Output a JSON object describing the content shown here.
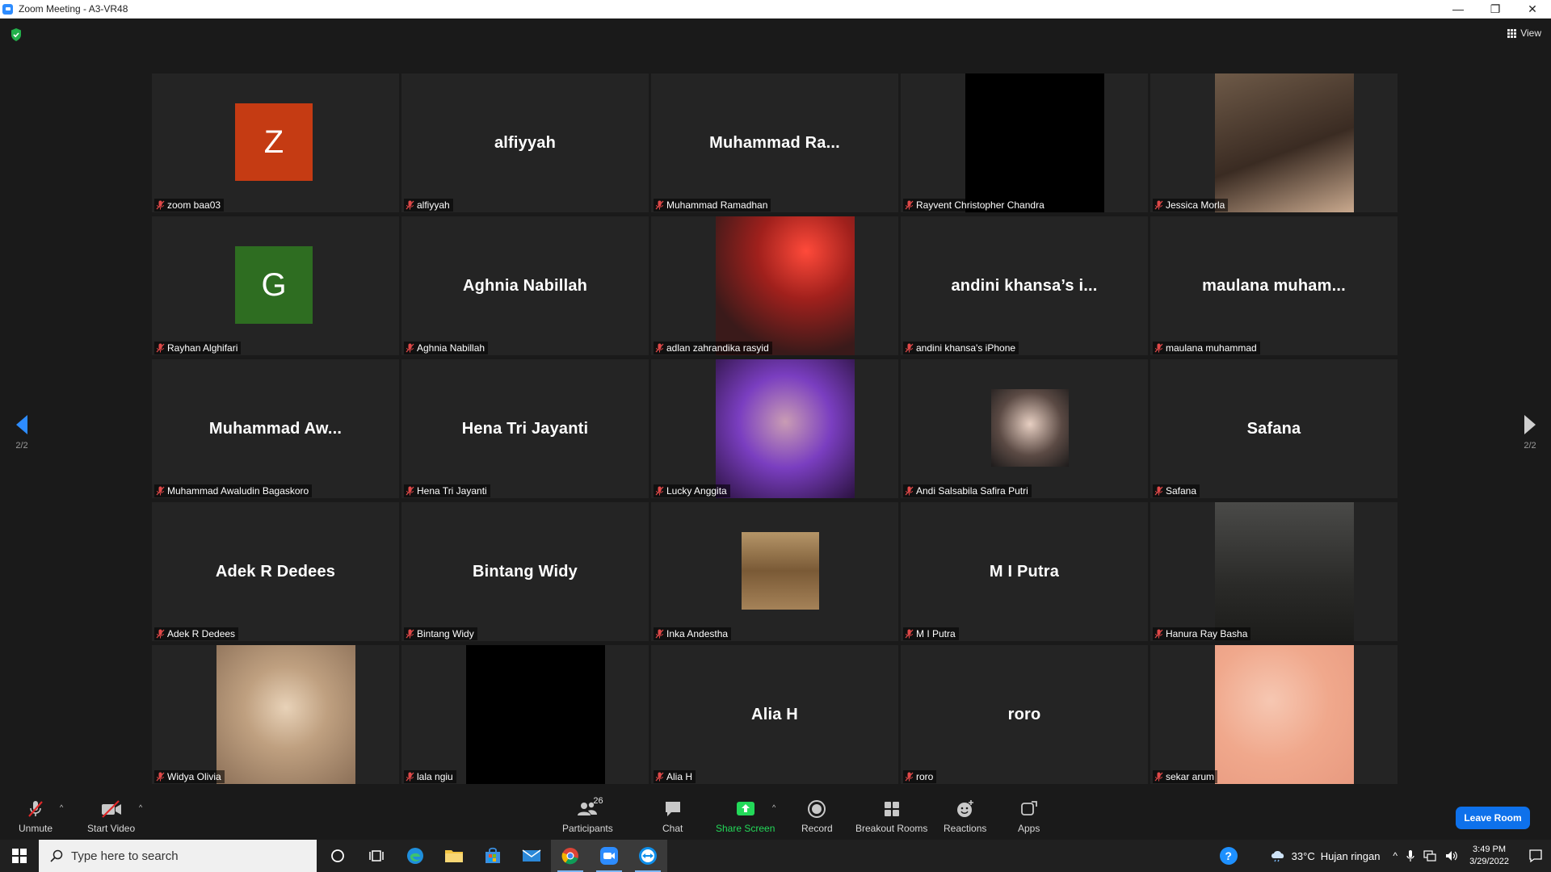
{
  "window": {
    "title": "Zoom Meeting - A3-VR48",
    "minimize": "—",
    "restore": "❐",
    "close": "✕"
  },
  "header": {
    "view_label": "View"
  },
  "pagination": {
    "left_page": "2/2",
    "right_page": "2/2"
  },
  "participants": [
    {
      "display": "Z",
      "kind": "avatar",
      "color": "#c53b13",
      "name": "zoom baa03"
    },
    {
      "display": "alfiyyah",
      "kind": "text",
      "name": "alfiyyah"
    },
    {
      "display": "Muhammad  Ra...",
      "kind": "text",
      "name": "Muhammad Ramadhan"
    },
    {
      "display": "",
      "kind": "video-black",
      "name": "Rayvent Christopher Chandra"
    },
    {
      "display": "",
      "kind": "video",
      "name": "Jessica Morla"
    },
    {
      "display": "G",
      "kind": "avatar",
      "color": "#2e6d21",
      "name": "Rayhan Alghifari"
    },
    {
      "display": "Aghnia Nabillah",
      "kind": "text",
      "name": "Aghnia Nabillah"
    },
    {
      "display": "",
      "kind": "video",
      "name": "adlan zahrandika rasyid"
    },
    {
      "display": "andini  khansa’s  i...",
      "kind": "text",
      "name": "andini khansa's iPhone"
    },
    {
      "display": "maulana  muham...",
      "kind": "text",
      "name": "maulana muhammad"
    },
    {
      "display": "Muhammad  Aw...",
      "kind": "text",
      "name": "Muhammad Awaludin Bagaskoro"
    },
    {
      "display": "Hena Tri Jayanti",
      "kind": "text",
      "name": "Hena Tri Jayanti"
    },
    {
      "display": "",
      "kind": "video",
      "name": "Lucky Anggita"
    },
    {
      "display": "",
      "kind": "photo-small",
      "name": "Andi Salsabila Safira Putri"
    },
    {
      "display": "Safana",
      "kind": "text",
      "name": "Safana"
    },
    {
      "display": "Adek R Dedees",
      "kind": "text",
      "name": "Adek R Dedees"
    },
    {
      "display": "Bintang Widy",
      "kind": "text",
      "name": "Bintang Widy"
    },
    {
      "display": "",
      "kind": "photo-small",
      "name": "Inka Andestha"
    },
    {
      "display": "M I Putra",
      "kind": "text",
      "name": "M I Putra"
    },
    {
      "display": "",
      "kind": "video",
      "name": "Hanura Ray Basha"
    },
    {
      "display": "",
      "kind": "video",
      "name": "Widya Olivia"
    },
    {
      "display": "",
      "kind": "video-black",
      "name": "lala ngiu"
    },
    {
      "display": "Alia H",
      "kind": "text",
      "name": "Alia H"
    },
    {
      "display": "roro",
      "kind": "text",
      "name": "roro"
    },
    {
      "display": "",
      "kind": "video",
      "name": "sekar arum"
    }
  ],
  "toolbar": {
    "unmute": "Unmute",
    "start_video": "Start Video",
    "participants": "Participants",
    "participants_count": "26",
    "chat": "Chat",
    "share_screen": "Share Screen",
    "record": "Record",
    "breakout_rooms": "Breakout Rooms",
    "reactions": "Reactions",
    "apps": "Apps",
    "leave_room": "Leave Room"
  },
  "taskbar": {
    "search_placeholder": "Type here to search",
    "weather_temp": "33°C",
    "weather_desc": "Hujan ringan",
    "time": "3:49 PM",
    "date": "3/29/2022"
  },
  "colors": {
    "accent": "#0e71eb",
    "share_green": "#23d959",
    "mute_red": "#e02828"
  }
}
